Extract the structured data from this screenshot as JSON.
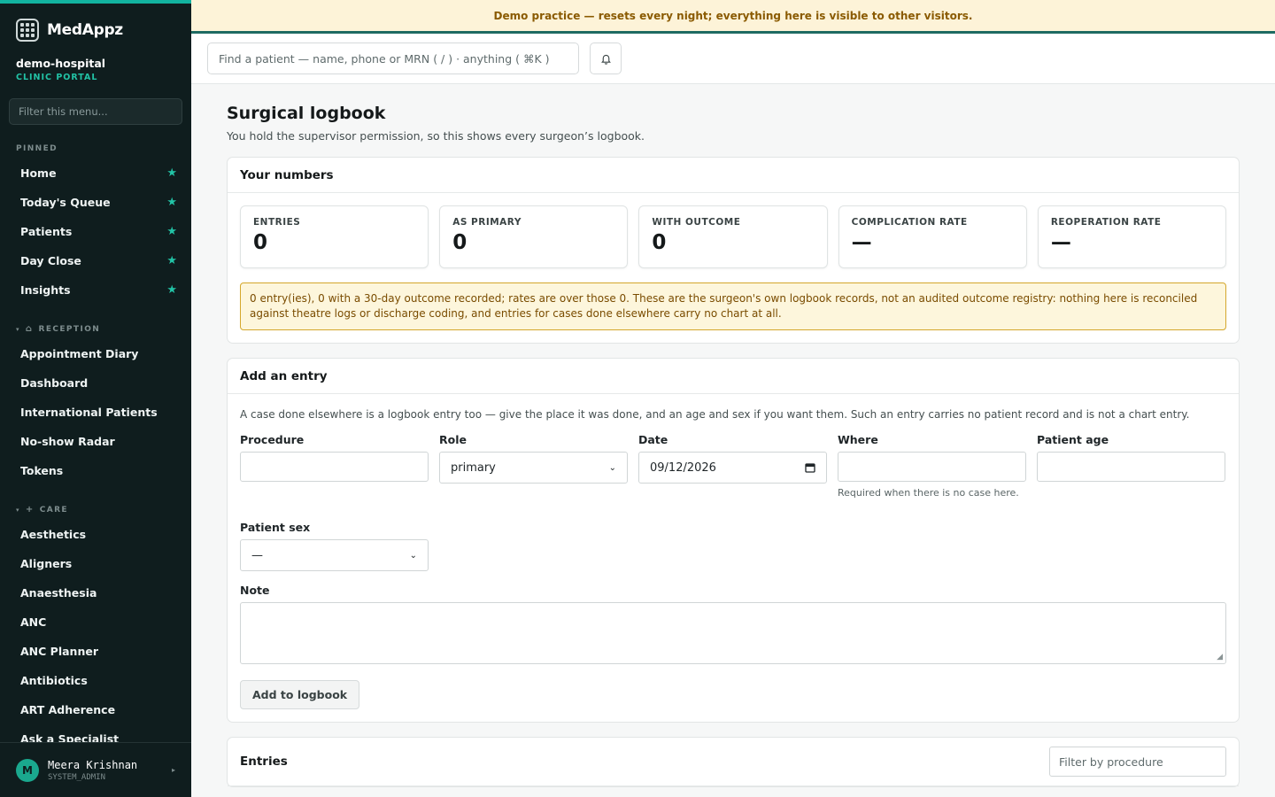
{
  "brand": {
    "name": "MedAppz",
    "logo_icon": "grid-logo-icon"
  },
  "tenant": {
    "name": "demo-hospital",
    "subtitle": "CLINIC PORTAL"
  },
  "sidebar": {
    "filter_placeholder": "Filter this menu...",
    "pinned_label": "PINNED",
    "pinned": [
      {
        "label": "Home"
      },
      {
        "label": "Today's Queue"
      },
      {
        "label": "Patients"
      },
      {
        "label": "Day Close"
      },
      {
        "label": "Insights"
      }
    ],
    "reception_label": "RECEPTION",
    "reception": [
      {
        "label": "Appointment Diary"
      },
      {
        "label": "Dashboard"
      },
      {
        "label": "International Patients"
      },
      {
        "label": "No-show Radar"
      },
      {
        "label": "Tokens"
      }
    ],
    "care_label": "CARE",
    "care": [
      {
        "label": "Aesthetics"
      },
      {
        "label": "Aligners"
      },
      {
        "label": "Anaesthesia"
      },
      {
        "label": "ANC"
      },
      {
        "label": "ANC Planner"
      },
      {
        "label": "Antibiotics"
      },
      {
        "label": "ART Adherence"
      },
      {
        "label": "Ask a Specialist"
      }
    ],
    "star_glyph": "★"
  },
  "user": {
    "initial": "M",
    "name": "Meera Krishnan",
    "role": "SYSTEM_ADMIN"
  },
  "banner": {
    "text": "Demo practice — resets every night; everything here is visible to other visitors."
  },
  "topbar": {
    "search_placeholder": "Find a patient — name, phone or MRN ( / ) · anything ( ⌘K )"
  },
  "page": {
    "title": "Surgical logbook",
    "subtitle": "You hold the supervisor permission, so this shows every surgeon’s logbook."
  },
  "numbers": {
    "title": "Your numbers",
    "stats": [
      {
        "label": "ENTRIES",
        "value": "0"
      },
      {
        "label": "AS PRIMARY",
        "value": "0"
      },
      {
        "label": "WITH OUTCOME",
        "value": "0"
      },
      {
        "label": "COMPLICATION RATE",
        "value": "—"
      },
      {
        "label": "REOPERATION RATE",
        "value": "—"
      }
    ],
    "notice": "0 entry(ies), 0 with a 30-day outcome recorded; rates are over those 0. These are the surgeon's own logbook records, not an audited outcome registry: nothing here is reconciled against theatre logs or discharge coding, and entries for cases done elsewhere carry no chart at all."
  },
  "add_entry": {
    "title": "Add an entry",
    "help": "A case done elsewhere is a logbook entry too — give the place it was done, and an age and sex if you want them. Such an entry carries no patient record and is not a chart entry.",
    "procedure_label": "Procedure",
    "procedure_value": "",
    "role_label": "Role",
    "role_value": "primary",
    "date_label": "Date",
    "date_value": "09/12/2026",
    "where_label": "Where",
    "where_value": "",
    "where_hint": "Required when there is no case here.",
    "age_label": "Patient age",
    "age_value": "",
    "sex_label": "Patient sex",
    "sex_value": "—",
    "note_label": "Note",
    "note_value": "",
    "submit_label": "Add to logbook"
  },
  "entries": {
    "title": "Entries",
    "filter_placeholder": "Filter by procedure"
  }
}
